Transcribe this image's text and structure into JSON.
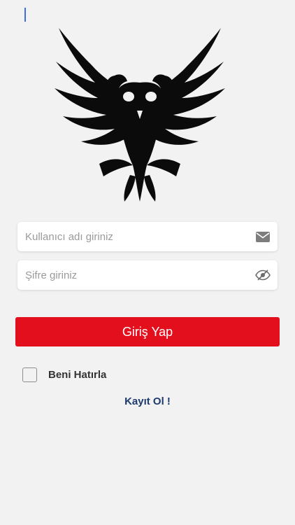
{
  "logo": {
    "icon": "double-headed-eagle-logo"
  },
  "username": {
    "placeholder": "Kullanıcı adı giriniz",
    "value": "",
    "icon": "envelope-icon"
  },
  "password": {
    "placeholder": "Şifre giriniz",
    "value": "",
    "icon": "eye-slash-icon"
  },
  "login_button": {
    "label": "Giriş Yap"
  },
  "remember": {
    "label": "Beni Hatırla",
    "checked": false
  },
  "register": {
    "label": "Kayıt Ol !"
  },
  "colors": {
    "primary": "#e30f1c",
    "link": "#1d3b6e",
    "background": "#f2f2f2"
  }
}
